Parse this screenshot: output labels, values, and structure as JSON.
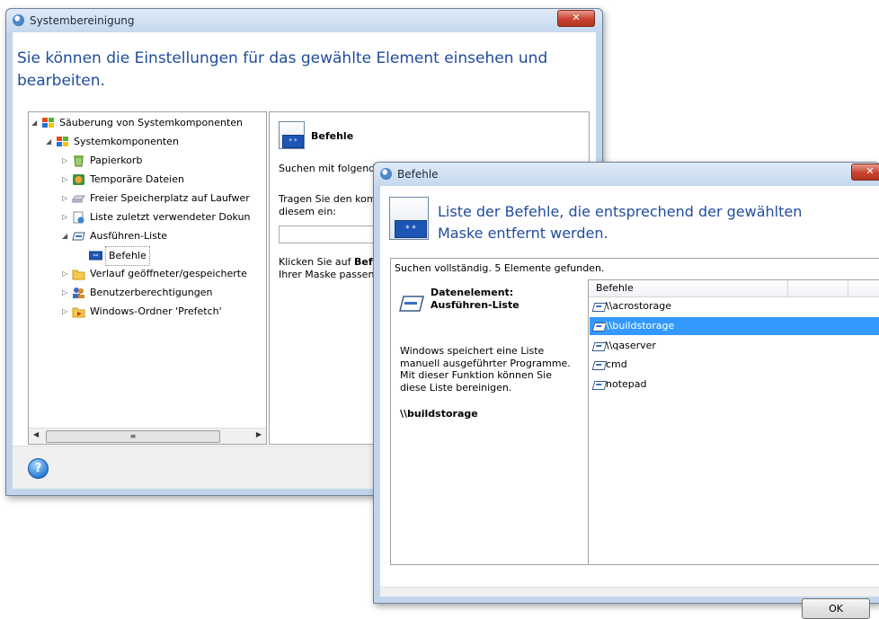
{
  "main_window": {
    "title": "Systembereinigung",
    "close_label": "✕",
    "heading": "Sie können die Einstellungen für das gewählte Element einsehen und bearbeiten.",
    "tree": {
      "root": "Säuberung von Systemkomponenten",
      "group": "Systemkomponenten",
      "items": [
        "Papierkorb",
        "Temporäre Dateien",
        "Freier Speicherplatz auf Laufwer",
        "Liste zuletzt verwendeter Dokun",
        "Ausführen-Liste",
        "Befehle",
        "Verlauf geöffneter/gespeicherte",
        "Benutzerberechtigungen",
        "Windows-Ordner 'Prefetch'"
      ]
    },
    "detail": {
      "title": "Befehle",
      "search_label": "Suchen mit folgend",
      "enter_text_line1": "Tragen Sie den kom",
      "enter_text_line2": "diesem ein:",
      "click_text_line1_prefix": "Klicken Sie auf ",
      "click_text_line1_bold": "Befe",
      "click_text_line2": "Ihrer Maske passen"
    },
    "help_label": "?"
  },
  "dialog": {
    "title": "Befehle",
    "close_label": "✕",
    "heading": "Liste der Befehle, die entsprechend der gewählten Maske entfernt werden.",
    "status": "Suchen vollständig. 5 Elemente gefunden.",
    "info": {
      "label": "Datenelement:",
      "name": "Ausführen-Liste",
      "description": "Windows speichert eine Liste manuell ausgeführter Programme. Mit dieser Funktion können Sie diese Liste bereinigen.",
      "selected_value": "\\\\buildstorage"
    },
    "list": {
      "column_header": "Befehle",
      "rows": [
        "\\\\acrostorage",
        "\\\\buildstorage",
        "\\\\qaserver",
        "cmd",
        "notepad"
      ],
      "selected_index": 1
    },
    "ok_label": "OK"
  }
}
